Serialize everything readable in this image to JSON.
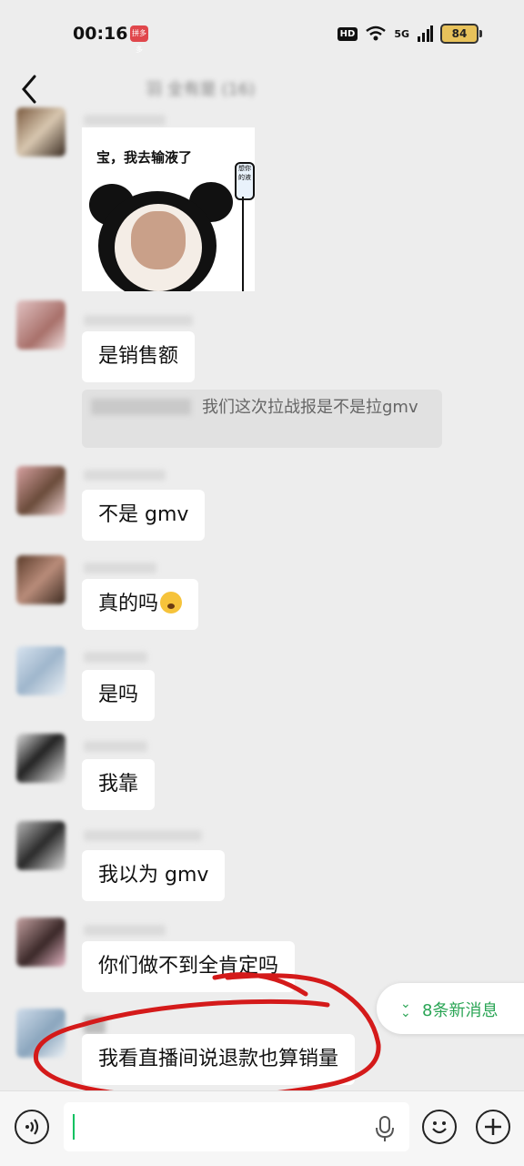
{
  "status_bar": {
    "time": "00:16",
    "app_badge": "拼多多",
    "hd": "HD",
    "network": "5G",
    "battery": "84"
  },
  "header": {
    "title": "羽 全有是 (16)"
  },
  "sticker": {
    "caption": "宝，我去输液了",
    "bag_text": "想你的液"
  },
  "messages": [
    {
      "text": "是销售额"
    },
    {
      "quote_text": "我们这次拉战报是不是拉gmv"
    },
    {
      "text": "不是 gmv"
    },
    {
      "text": "真的吗"
    },
    {
      "text": "是吗"
    },
    {
      "text": "我靠"
    },
    {
      "text": "我以为 gmv"
    },
    {
      "text": "你们做不到全肯定吗"
    },
    {
      "text": "我看直播间说退款也算销量"
    }
  ],
  "new_messages": "8条新消息",
  "colors": {
    "accent": "#2aa555",
    "background": "#ededed",
    "annotation": "#d41a1a"
  }
}
